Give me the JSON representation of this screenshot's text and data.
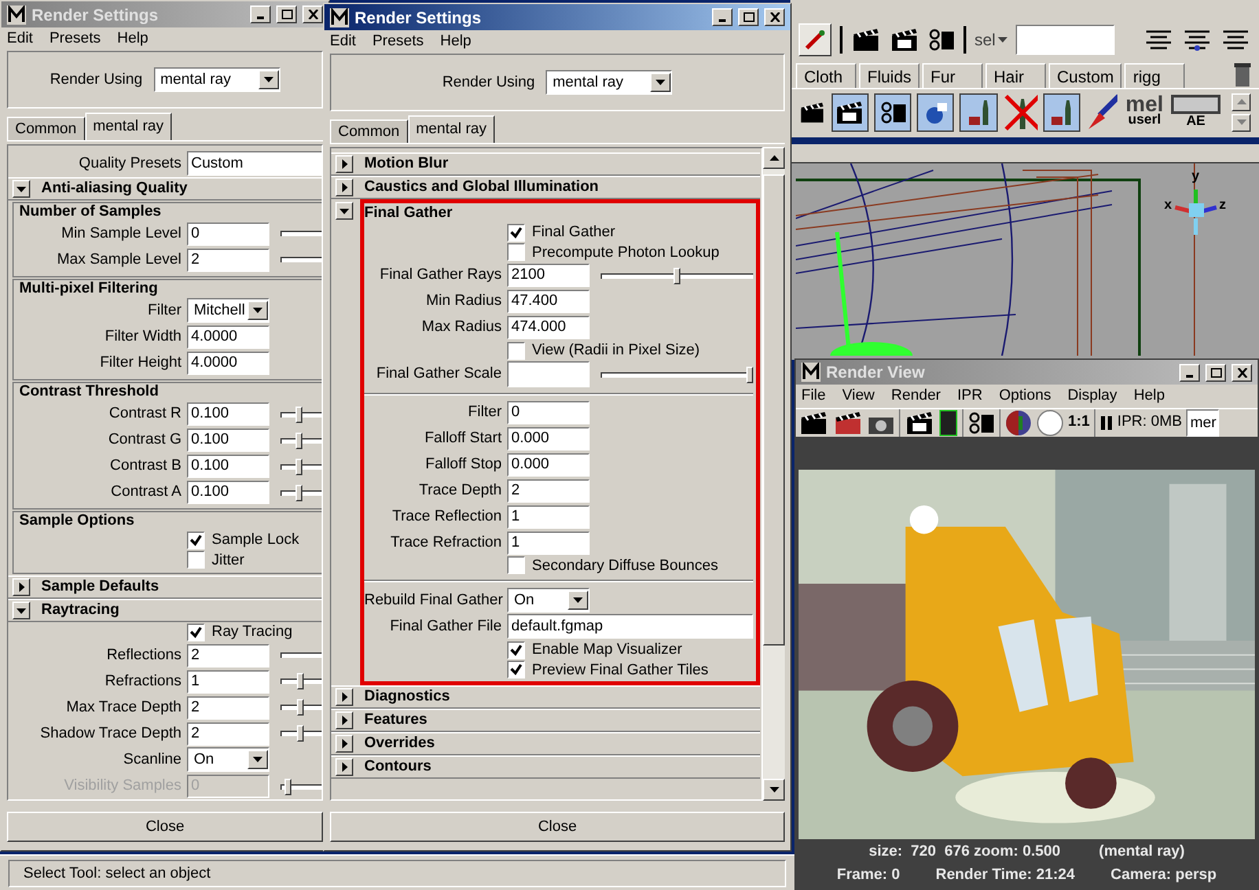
{
  "left_window": {
    "title": "Render Settings",
    "active": false,
    "menu": [
      "Edit",
      "Presets",
      "Help"
    ],
    "render_using": {
      "label": "Render Using",
      "value": "mental ray"
    },
    "tabs": [
      {
        "label": "Common",
        "selected": false
      },
      {
        "label": "mental ray",
        "selected": true
      }
    ],
    "rows": [
      {
        "kind": "text",
        "label": "Quality Presets",
        "value": "Custom"
      },
      {
        "kind": "section",
        "label": "Anti-aliasing Quality",
        "expanded": true,
        "highlighted": false,
        "rows": [
          {
            "kind": "group",
            "label": "Number of Samples",
            "rows": [
              {
                "kind": "field",
                "label": "Min Sample Level",
                "value": "0",
                "slider": true
              },
              {
                "kind": "field",
                "label": "Max Sample Level",
                "value": "2",
                "slider": true
              }
            ]
          },
          {
            "kind": "group",
            "label": "Multi-pixel Filtering",
            "rows": [
              {
                "kind": "dropdown",
                "label": "Filter",
                "value": "Mitchell"
              },
              {
                "kind": "field",
                "label": "Filter Width",
                "value": "4.0000"
              },
              {
                "kind": "field",
                "label": "Filter Height",
                "value": "4.0000"
              }
            ]
          },
          {
            "kind": "group",
            "label": "Contrast Threshold",
            "rows": [
              {
                "kind": "field",
                "label": "Contrast R",
                "value": "0.100",
                "level": 0.11
              },
              {
                "kind": "field",
                "label": "Contrast G",
                "value": "0.100",
                "level": 0.11
              },
              {
                "kind": "field",
                "label": "Contrast B",
                "value": "0.100",
                "level": 0.11
              },
              {
                "kind": "field",
                "label": "Contrast A",
                "value": "0.100",
                "level": 0.11
              }
            ]
          },
          {
            "kind": "group",
            "label": "Sample Options",
            "rows": [
              {
                "kind": "checkbox",
                "label": "Sample Lock",
                "checked": true
              },
              {
                "kind": "checkbox",
                "label": "Jitter",
                "checked": false
              }
            ]
          }
        ]
      },
      {
        "kind": "section",
        "label": "Sample Defaults",
        "expanded": false,
        "highlighted": false,
        "rows": []
      },
      {
        "kind": "section",
        "label": "Raytracing",
        "expanded": true,
        "highlighted": false,
        "rows": [
          {
            "kind": "checkbox",
            "label": "Ray Tracing",
            "checked": true
          },
          {
            "kind": "field",
            "label": "Reflections",
            "value": "2",
            "slider": true
          },
          {
            "kind": "field",
            "label": "Refractions",
            "value": "1",
            "level": 0.11
          },
          {
            "kind": "field",
            "label": "Max Trace Depth",
            "value": "2",
            "level": 0.11
          },
          {
            "kind": "field",
            "label": "Shadow Trace Depth",
            "value": "2",
            "level": 0.11
          },
          {
            "kind": "dropdown",
            "label": "Scanline",
            "value": "On"
          },
          {
            "kind": "field",
            "label": "Visibility Samples",
            "value": "0",
            "level": 0.03,
            "disabled": true
          }
        ]
      }
    ],
    "close_label": "Close"
  },
  "middle_window": {
    "title": "Render Settings",
    "active": true,
    "menu": [
      "Edit",
      "Presets",
      "Help"
    ],
    "render_using": {
      "label": "Render Using",
      "value": "mental ray"
    },
    "tabs": [
      {
        "label": "Common",
        "selected": false
      },
      {
        "label": "mental ray",
        "selected": true
      }
    ],
    "rows": [
      {
        "kind": "section",
        "label": "Motion Blur",
        "expanded": false,
        "highlighted": false,
        "rows": []
      },
      {
        "kind": "section",
        "label": "Caustics and Global Illumination",
        "expanded": false,
        "highlighted": false,
        "rows": []
      },
      {
        "kind": "section",
        "label": "Final Gather",
        "expanded": true,
        "highlighted": true,
        "rows": [
          {
            "kind": "checkbox",
            "label": "Final Gather",
            "checked": true
          },
          {
            "kind": "checkbox",
            "label": "Precompute Photon Lookup",
            "checked": false
          },
          {
            "kind": "field",
            "label": "Final Gather Rays",
            "value": "2100",
            "level": 0.5
          },
          {
            "kind": "field",
            "label": "Min Radius",
            "value": "47.400"
          },
          {
            "kind": "field",
            "label": "Max Radius",
            "value": "474.000"
          },
          {
            "kind": "checkbox",
            "label": "View (Radii in Pixel Size)",
            "checked": false
          },
          {
            "kind": "color",
            "label": "Final Gather Scale",
            "level": 1
          },
          {
            "kind": "divider"
          },
          {
            "kind": "field",
            "label": "Filter",
            "value": "0"
          },
          {
            "kind": "field",
            "label": "Falloff Start",
            "value": "0.000"
          },
          {
            "kind": "field",
            "label": "Falloff Stop",
            "value": "0.000"
          },
          {
            "kind": "field",
            "label": "Trace Depth",
            "value": "2"
          },
          {
            "kind": "field",
            "label": "Trace Reflection",
            "value": "1"
          },
          {
            "kind": "field",
            "label": "Trace Refraction",
            "value": "1"
          },
          {
            "kind": "checkbox",
            "label": "Secondary Diffuse Bounces",
            "checked": false
          },
          {
            "kind": "divider"
          },
          {
            "kind": "dropdown",
            "label": "Rebuild Final Gather",
            "value": "On"
          },
          {
            "kind": "text",
            "label": "Final Gather File",
            "value": "default.fgmap"
          },
          {
            "kind": "checkbox",
            "label": "Enable Map Visualizer",
            "checked": true
          },
          {
            "kind": "checkbox",
            "label": "Preview Final Gather Tiles",
            "checked": true
          }
        ]
      },
      {
        "kind": "section",
        "label": "Diagnostics",
        "expanded": false,
        "highlighted": false,
        "rows": []
      },
      {
        "kind": "section",
        "label": "Features",
        "expanded": false,
        "highlighted": false,
        "rows": []
      },
      {
        "kind": "section",
        "label": "Overrides",
        "expanded": false,
        "highlighted": false,
        "rows": []
      },
      {
        "kind": "section",
        "label": "Contours",
        "expanded": false,
        "highlighted": false,
        "rows": []
      }
    ],
    "close_label": "Close"
  },
  "maya": {
    "sel_label": "sel",
    "shelf_tabs": [
      "Cloth",
      "Fluids",
      "Fur",
      "Hair",
      "Custom",
      "rigg"
    ],
    "script_shelf_button": {
      "label": "mel",
      "caption": "userl"
    },
    "editor_shelf_button": {
      "caption": "AE"
    },
    "axis_labels": [
      "y",
      "x",
      "z"
    ]
  },
  "render_view": {
    "title": "Render View",
    "active": false,
    "menu": [
      "File",
      "View",
      "Render",
      "IPR",
      "Options",
      "Display",
      "Help"
    ],
    "zoom_label": "1:1",
    "ipr_label": "IPR: 0MB",
    "renderer_field": "mer",
    "info_line_1": [
      "size:  720  676 zoom: 0.500",
      "(mental ray)"
    ],
    "info_line_2": [
      "Frame: 0",
      "Render Time: 21:24",
      "Camera: persp"
    ]
  },
  "status_bar": {
    "message": "Select Tool: select an object"
  }
}
